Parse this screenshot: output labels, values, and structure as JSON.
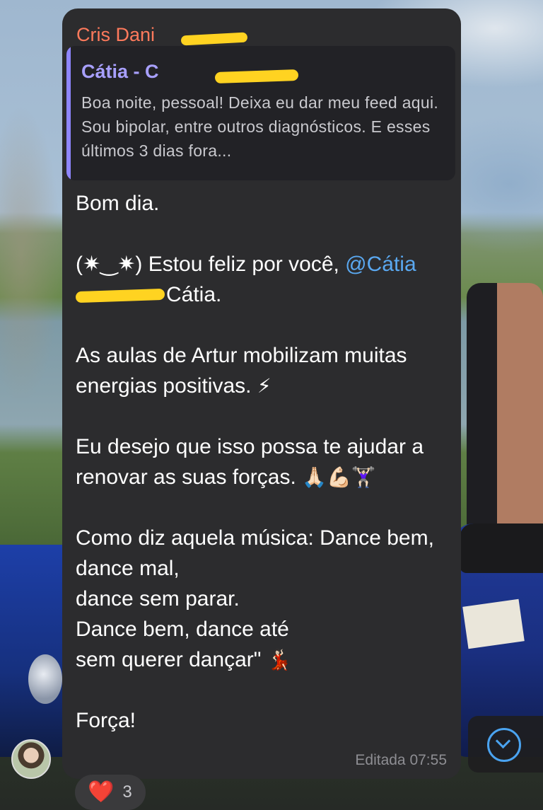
{
  "message": {
    "sender": "Cris Dani",
    "reply": {
      "author": "Cátia - C",
      "text": "Boa noite, pessoal! Deixa eu dar meu feed aqui. Sou bipolar, entre outros diagnósticos. E esses últimos 3 dias fora..."
    },
    "lines": {
      "l1": "Bom dia.",
      "l2a": "(✷‿✷) Estou feliz por você, ",
      "l2_mention": "@Cátia",
      "l2b": "Cátia.",
      "l3": "As aulas de Artur mobilizam muitas energias positivas. ",
      "l3_emoji": "⚡",
      "l4": "Eu desejo que isso possa te ajudar a renovar as suas forças. ",
      "l4_emoji": "🙏🏻💪🏻🏋🏻‍♀️",
      "l5a": "Como diz aquela música: Dance bem,",
      "l5b": "dance mal,",
      "l5c": "dance sem parar.",
      "l5d": "Dance bem, dance até",
      "l5e": "sem querer dançar\" ",
      "l5_emoji": "💃🏻",
      "l6": "Força!"
    },
    "meta": "Editada 07:55"
  },
  "reaction": {
    "emoji": "❤️",
    "count": "3"
  },
  "icons": {
    "scroll_down": "chevron-down-circle-icon"
  },
  "colors": {
    "bubble": "#2c2c2e",
    "sender": "#ff7a5c",
    "reply_accent": "#8f86ff",
    "mention": "#5aa8f0"
  }
}
